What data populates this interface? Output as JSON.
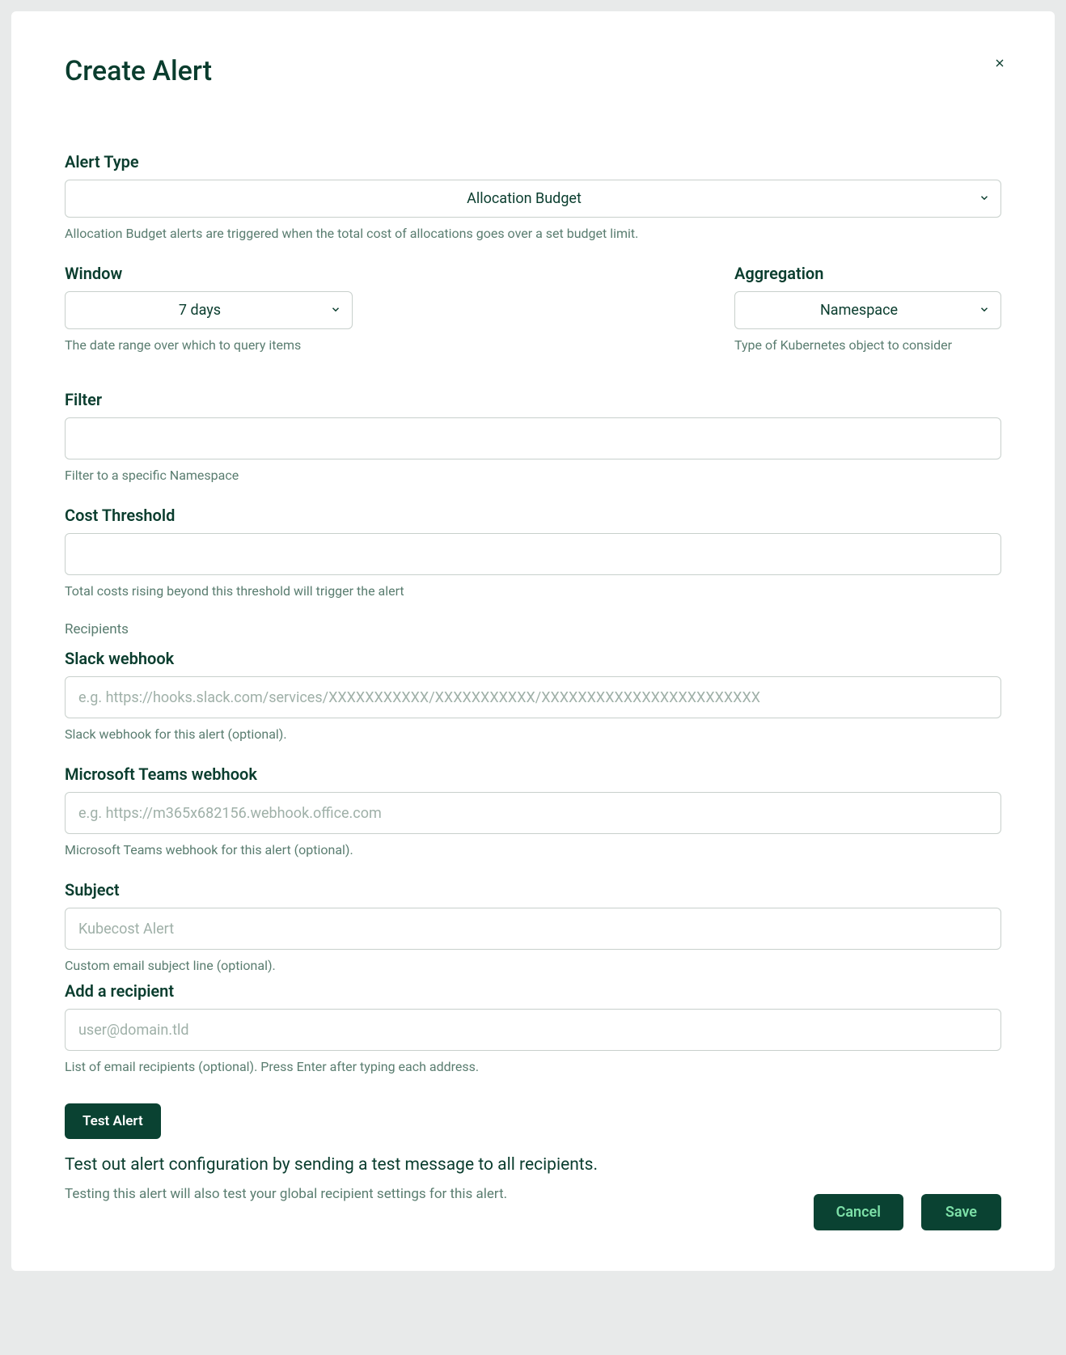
{
  "modal": {
    "title": "Create Alert"
  },
  "alertType": {
    "label": "Alert Type",
    "value": "Allocation Budget",
    "help": "Allocation Budget alerts are triggered when the total cost of allocations goes over a set budget limit."
  },
  "window": {
    "label": "Window",
    "value": "7 days",
    "help": "The date range over which to query items"
  },
  "aggregation": {
    "label": "Aggregation",
    "value": "Namespace",
    "help": "Type of Kubernetes object to consider"
  },
  "filter": {
    "label": "Filter",
    "value": "",
    "help": "Filter to a specific Namespace"
  },
  "costThreshold": {
    "label": "Cost Threshold",
    "value": "",
    "help": "Total costs rising beyond this threshold will trigger the alert"
  },
  "recipients": {
    "label": "Recipients"
  },
  "slackWebhook": {
    "label": "Slack webhook",
    "placeholder": "e.g. https://hooks.slack.com/services/XXXXXXXXXXX/XXXXXXXXXXX/XXXXXXXXXXXXXXXXXXXXXXXX",
    "value": "",
    "help": "Slack webhook for this alert (optional)."
  },
  "teamsWebhook": {
    "label": "Microsoft Teams webhook",
    "placeholder": "e.g. https://m365x682156.webhook.office.com",
    "value": "",
    "help": "Microsoft Teams webhook for this alert (optional)."
  },
  "subject": {
    "label": "Subject",
    "placeholder": "Kubecost Alert",
    "value": "",
    "help": "Custom email subject line (optional)."
  },
  "addRecipient": {
    "label": "Add a recipient",
    "placeholder": "user@domain.tld",
    "value": "",
    "help": "List of email recipients (optional). Press Enter after typing each address."
  },
  "testAlert": {
    "button": "Test Alert",
    "desc": "Test out alert configuration by sending a test message to all recipients.",
    "subdesc": "Testing this alert will also test your global recipient settings for this alert."
  },
  "footer": {
    "cancel": "Cancel",
    "save": "Save"
  }
}
